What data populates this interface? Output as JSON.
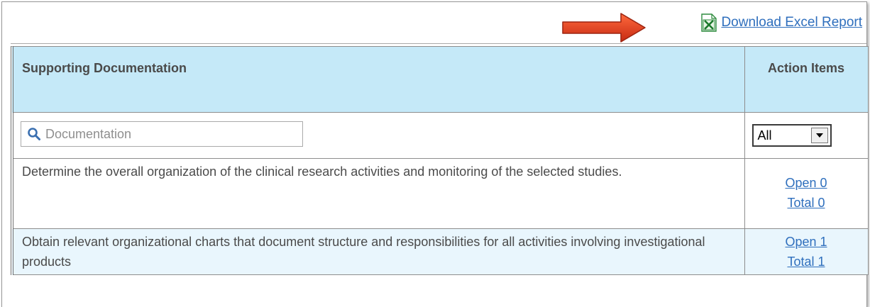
{
  "toolbar": {
    "download_label": "Download Excel Report"
  },
  "table": {
    "headers": {
      "documentation": "Supporting Documentation",
      "action_items": "Action Items"
    },
    "filters": {
      "search_placeholder": "Documentation",
      "action_select_value": "All"
    },
    "rows": [
      {
        "description": "Determine the overall organization of the clinical research activities and monitoring of the selected studies.",
        "open_label": "Open 0",
        "total_label": "Total 0"
      },
      {
        "description": "Obtain relevant organizational charts that document structure and responsibilities for all activities involving investigational products",
        "open_label": "Open 1",
        "total_label": "Total 1"
      }
    ]
  },
  "colors": {
    "header_bg": "#c5e9f8",
    "alt_row_bg": "#e9f6fd",
    "link": "#2f6fbd",
    "annotation_arrow": "#e0391c"
  },
  "icons": {
    "download": "excel-file-icon",
    "search": "magnifier-icon",
    "dropdown": "triangle-down-icon",
    "annotation": "red-arrow"
  }
}
